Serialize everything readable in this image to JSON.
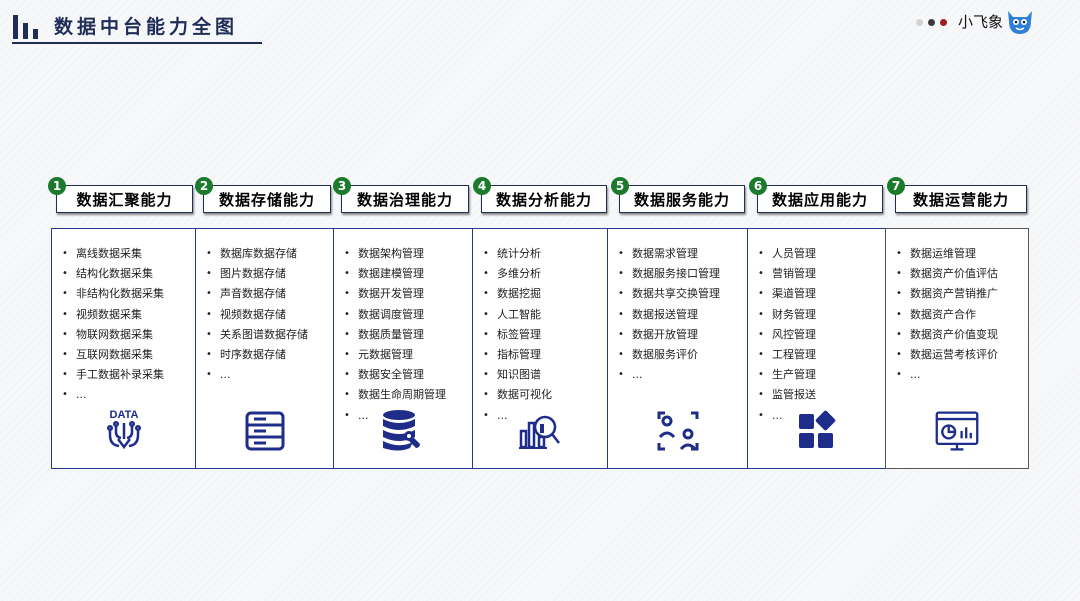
{
  "header": {
    "title": "数据中台能力全图",
    "brand": "小飞象",
    "dot_colors": [
      "#d3d3d3",
      "#3a3a3a",
      "#a11d1d"
    ]
  },
  "capabilities": [
    {
      "num": "1",
      "title": "数据汇聚能力",
      "icon": "data-collection-icon",
      "items": [
        "离线数据采集",
        "结构化数据采集",
        "非结构化数据采集",
        "视频数据采集",
        "物联网数据采集",
        "互联网数据采集",
        "手工数据补录采集",
        "..."
      ]
    },
    {
      "num": "2",
      "title": "数据存储能力",
      "icon": "server-storage-icon",
      "items": [
        "数据库数据存储",
        "图片数据存储",
        "声音数据存储",
        "视频数据存储",
        "关系图谱数据存储",
        "时序数据存储",
        "..."
      ]
    },
    {
      "num": "3",
      "title": "数据治理能力",
      "icon": "database-wrench-icon",
      "items": [
        "数据架构管理",
        "数据建模管理",
        "数据开发管理",
        "数据调度管理",
        "数据质量管理",
        "元数据管理",
        "数据安全管理",
        "数据生命周期管理",
        "..."
      ]
    },
    {
      "num": "4",
      "title": "数据分析能力",
      "icon": "chart-magnifier-icon",
      "items": [
        "统计分析",
        "多维分析",
        "数据挖掘",
        "人工智能",
        "标签管理",
        "指标管理",
        "知识图谱",
        "数据可视化",
        "..."
      ]
    },
    {
      "num": "5",
      "title": "数据服务能力",
      "icon": "user-scan-icon",
      "items": [
        "数据需求管理",
        "数据服务接口管理",
        "数据共享交换管理",
        "数据报送管理",
        "数据开放管理",
        "数据服务评价",
        "..."
      ]
    },
    {
      "num": "6",
      "title": "数据应用能力",
      "icon": "apps-grid-icon",
      "items": [
        "人员管理",
        "营销管理",
        "渠道管理",
        "财务管理",
        "风控管理",
        "工程管理",
        "生产管理",
        "监管报送",
        "..."
      ]
    },
    {
      "num": "7",
      "title": "数据运营能力",
      "icon": "dashboard-monitor-icon",
      "items": [
        "数据运维管理",
        "数据资产价值评估",
        "数据资产营销推广",
        "数据资产合作",
        "数据资产价值变现",
        "数据运营考核评价",
        "",
        "..."
      ]
    }
  ]
}
